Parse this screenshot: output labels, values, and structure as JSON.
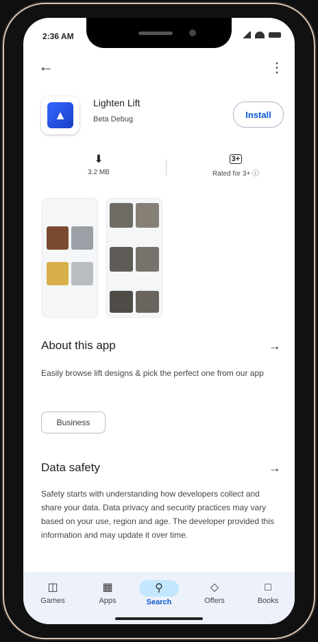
{
  "status": {
    "time": "2:36 AM"
  },
  "app": {
    "name": "Lighten Lift",
    "subtitle": "Beta Debug",
    "install_label": "Install"
  },
  "meta": {
    "size": "3.2 MB",
    "rating_badge": "3+",
    "rating_text": "Rated for 3+ ⓘ"
  },
  "about": {
    "title": "About this app",
    "description": "Easily browse lift designs & pick the perfect one from our app",
    "chip": "Business"
  },
  "safety": {
    "title": "Data safety",
    "description": "Safety starts with understanding how developers collect and share your data. Data privacy and security practices may vary based on your use, region and age. The developer provided this information and may update it over time."
  },
  "nav": {
    "items": [
      {
        "label": "Games",
        "icon": "gamepad-icon"
      },
      {
        "label": "Apps",
        "icon": "apps-grid-icon"
      },
      {
        "label": "Search",
        "icon": "search-icon"
      },
      {
        "label": "Offers",
        "icon": "tag-icon"
      },
      {
        "label": "Books",
        "icon": "book-icon"
      }
    ]
  },
  "colors": {
    "accent": "#0b57d0",
    "active_pill": "#c2e7ff",
    "nav_bg": "#edf1f9",
    "frame": "#d9c7b4"
  }
}
